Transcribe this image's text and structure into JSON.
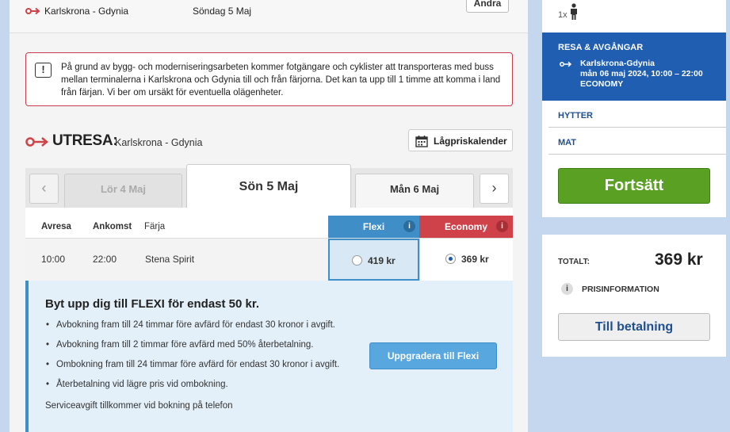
{
  "topbar": {
    "route": "Karlskrona - Gdynia",
    "date": "Söndag 5 Maj",
    "change_label": "Ändra"
  },
  "alert": {
    "text": "På grund av bygg- och moderniseringsarbeten kommer fotgängare och cyklister att transporteras med buss mellan terminalerna i Karlskrona och Gdynia till och från färjorna. Det kan ta upp till 1 timme att komma i land från färjan. Vi ber om ursäkt för eventuella olägenheter."
  },
  "outbound": {
    "title": "UTRESA:",
    "route": "Karlskrona - Gdynia",
    "lowprice_label": "Lågpriskalender"
  },
  "dates": {
    "prev_arrow": "‹",
    "next_arrow": "›",
    "prev": "Lör 4 Maj",
    "active": "Sön 5 Maj",
    "next": "Mån 6 Maj"
  },
  "table": {
    "headers": {
      "departure": "Avresa",
      "arrival": "Ankomst",
      "ferry": "Färja",
      "flexi": "Flexi",
      "economy": "Economy"
    },
    "rows": [
      {
        "departure": "10:00",
        "arrival": "22:00",
        "ferry": "Stena Spirit",
        "flexi_price": "419 kr",
        "economy_price": "369 kr",
        "selected": "economy"
      }
    ]
  },
  "upsell": {
    "title": "Byt upp dig till FLEXI för endast 50 kr.",
    "items": [
      "Avbokning fram till 24 timmar före avfärd för endast 30 kronor i avgift.",
      "Avbokning fram till 2 timmar före avfärd med 50% återbetalning.",
      "Ombokning fram till 24 timmar före avfärd för endast 30 kronor i avgift.",
      "Återbetalning vid lägre pris vid ombokning."
    ],
    "note": "Serviceavgift tillkommer vid bokning på telefon",
    "button_label": "Uppgradera till Flexi"
  },
  "sidebar": {
    "passengers": "1x",
    "trip_title": "RESA & AVGÅNGAR",
    "trip_route": "Karlskrona-Gdynia",
    "trip_datetime": "mån 06 maj 2024, 10:00 – 22:00",
    "trip_class": "ECONOMY",
    "cabins_label": "HYTTER",
    "food_label": "MAT",
    "continue_label": "Fortsätt"
  },
  "summary": {
    "total_label": "TOTALT:",
    "total_value": "369 kr",
    "price_info_label": "PRISINFORMATION",
    "pay_label": "Till betalning"
  },
  "colors": {
    "brand_blue": "#1f5eb0",
    "flexi_blue": "#3f8ec8",
    "economy_red": "#d0424a",
    "continue_green": "#5aa022",
    "alert_red": "#c83b48"
  }
}
